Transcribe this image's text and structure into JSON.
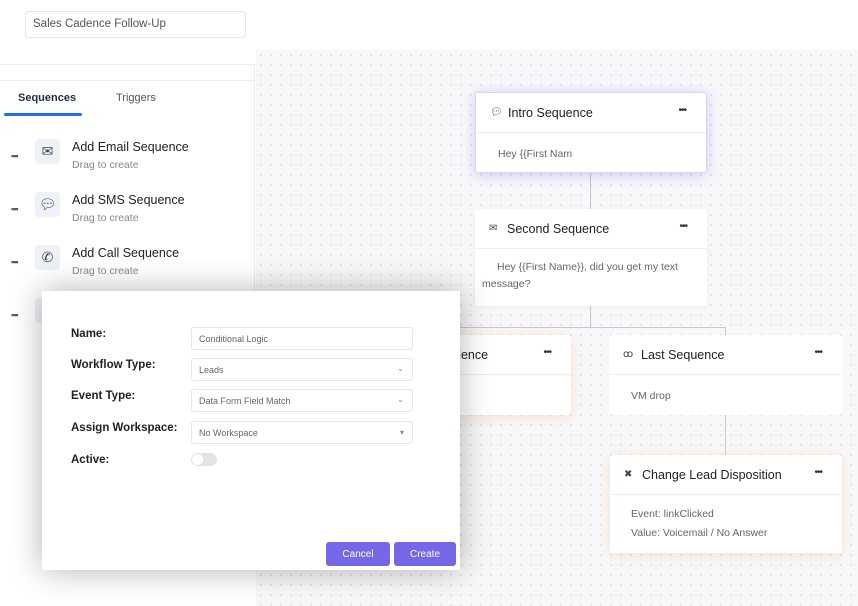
{
  "workflow_name": "Sales Cadence Follow-Up",
  "sidebar": {
    "tabs": [
      {
        "label": "Sequences",
        "active": true
      },
      {
        "label": "Triggers",
        "active": false
      }
    ],
    "items": [
      {
        "title": "Add Email Sequence",
        "subtitle": "Drag to create",
        "icon": "envelope-icon"
      },
      {
        "title": "Add SMS Sequence",
        "subtitle": "Drag to create",
        "icon": "chat-bubble-icon"
      },
      {
        "title": "Add Call Sequence",
        "subtitle": "Drag to create",
        "icon": "phone-icon"
      }
    ]
  },
  "canvas": {
    "cards": [
      {
        "title": "Intro Sequence",
        "body": "Hey {{First Nam",
        "icon": "chat-bubble-icon"
      },
      {
        "title": "Second Sequence",
        "body": "Hey {{First Name}}, did you get my text message?",
        "icon": "envelope-icon"
      },
      {
        "title": "dence",
        "icon": ""
      },
      {
        "title": "Last Sequence",
        "body": "VM drop",
        "icon": "voicemail-icon"
      },
      {
        "title": "Change Lead Disposition",
        "body_lines": [
          "Event: linkClicked",
          "Value: Voicemail / No Answer"
        ],
        "icon": "close-icon"
      }
    ],
    "more_label": "•••"
  },
  "modal": {
    "name_label": "Name:",
    "name_value": "Conditional Logic",
    "workflow_type_label": "Workflow Type:",
    "workflow_type_value": "Leads",
    "event_type_label": "Event Type:",
    "event_type_value": "Data Form Field Match",
    "workspace_label": "Assign Workspace:",
    "workspace_value": "No Workspace",
    "active_label": "Active:",
    "active": false,
    "cancel_label": "Cancel",
    "create_label": "Create"
  },
  "colors": {
    "accent": "#7666e8",
    "tab_underline": "#1a73e8"
  }
}
